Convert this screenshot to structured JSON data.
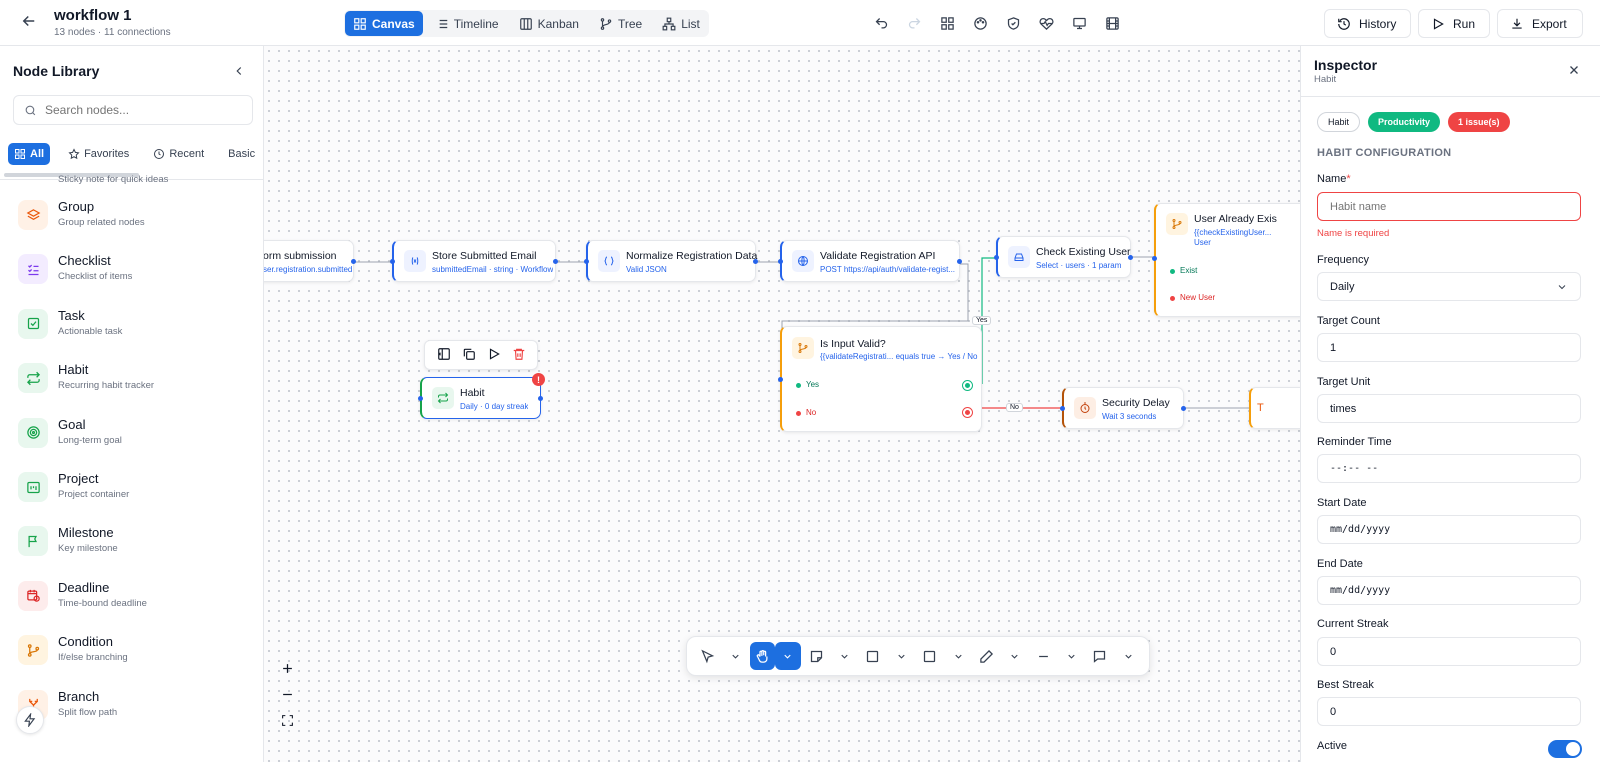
{
  "header": {
    "title": "workflow 1",
    "subtitle": "13 nodes · 11 connections",
    "views": [
      {
        "label": "Canvas",
        "active": true
      },
      {
        "label": "Timeline"
      },
      {
        "label": "Kanban"
      },
      {
        "label": "Tree"
      },
      {
        "label": "List"
      }
    ],
    "history_label": "History",
    "run_label": "Run",
    "export_label": "Export"
  },
  "library": {
    "title": "Node Library",
    "search_placeholder": "Search nodes...",
    "categories": [
      "All",
      "Favorites",
      "Recent",
      "Basic",
      "P"
    ],
    "items": [
      {
        "name": "Group",
        "desc": "Group related nodes",
        "icon": "layers-icon",
        "color": "#ea580c",
        "bg": "#fff1e6"
      },
      {
        "name": "Checklist",
        "desc": "Checklist of items",
        "icon": "checklist-icon",
        "color": "#7c3aed",
        "bg": "#f3ecff"
      },
      {
        "name": "Task",
        "desc": "Actionable task",
        "icon": "check-square-icon",
        "color": "#16a34a",
        "bg": "#e8f7ee"
      },
      {
        "name": "Habit",
        "desc": "Recurring habit tracker",
        "icon": "repeat-icon",
        "color": "#16a34a",
        "bg": "#e8f7ee"
      },
      {
        "name": "Goal",
        "desc": "Long-term goal",
        "icon": "target-icon",
        "color": "#16a34a",
        "bg": "#e8f7ee"
      },
      {
        "name": "Project",
        "desc": "Project container",
        "icon": "project-icon",
        "color": "#16a34a",
        "bg": "#e8f7ee"
      },
      {
        "name": "Milestone",
        "desc": "Key milestone",
        "icon": "flag-icon",
        "color": "#16a34a",
        "bg": "#e8f7ee"
      },
      {
        "name": "Deadline",
        "desc": "Time-bound deadline",
        "icon": "calendar-clock-icon",
        "color": "#dc2626",
        "bg": "#fdecec"
      },
      {
        "name": "Condition",
        "desc": "If/else branching",
        "icon": "branch-icon",
        "color": "#d97706",
        "bg": "#fff4e0"
      },
      {
        "name": "Branch",
        "desc": "Split flow path",
        "icon": "split-icon",
        "color": "#ea580c",
        "bg": "#fff1e6"
      }
    ],
    "partial_item_desc": "Sticky note for quick ideas"
  },
  "canvas": {
    "nodes": {
      "form": {
        "title": "orm submission",
        "sub": "ser.registration.submitted"
      },
      "store": {
        "title": "Store Submitted Email",
        "sub": "submittedEmail · string · Workflow"
      },
      "normalize": {
        "title": "Normalize Registration Data",
        "sub": "Valid JSON"
      },
      "validate": {
        "title": "Validate Registration API",
        "sub": "POST https://api/auth/validate-regist..."
      },
      "check": {
        "title": "Check Existing User",
        "sub": "Select · users · 1 param"
      },
      "exists": {
        "title": "User Already Exis",
        "sub": "{{checkExistingUser...",
        "sub2": "User",
        "out1": "Exist",
        "out2": "New User"
      },
      "valid": {
        "title": "Is Input Valid?",
        "sub": "{{validateRegistrati... equals true → Yes / No",
        "out1": "Yes",
        "out2": "No"
      },
      "habit": {
        "title": "Habit",
        "sub": "Daily · 0 day streak"
      },
      "delay": {
        "title": "Security Delay",
        "sub": "Wait 3 seconds"
      }
    },
    "edge_labels": {
      "yes": "Yes",
      "no": "No"
    }
  },
  "inspector": {
    "title": "Inspector",
    "subtitle": "Habit",
    "badges": [
      "Habit",
      "Productivity",
      "1 issue(s)"
    ],
    "section": "HABIT CONFIGURATION",
    "name_label": "Name",
    "name_required_marker": "*",
    "name_placeholder": "Habit name",
    "name_error": "Name is required",
    "frequency_label": "Frequency",
    "frequency_value": "Daily",
    "target_count_label": "Target Count",
    "target_count_value": "1",
    "target_unit_label": "Target Unit",
    "target_unit_value": "times",
    "reminder_label": "Reminder Time",
    "reminder_value": "--:-- --",
    "start_label": "Start Date",
    "start_value": "mm/dd/yyyy",
    "end_label": "End Date",
    "end_value": "mm/dd/yyyy",
    "current_streak_label": "Current Streak",
    "current_streak_value": "0",
    "best_streak_label": "Best Streak",
    "best_streak_value": "0",
    "active_label": "Active",
    "active_on": true
  },
  "colors": {
    "accent": "#1d6fe0",
    "productivity": "#10b981",
    "issue": "#ef4444",
    "condition": "#f59e0b",
    "delay": "#b45309"
  }
}
